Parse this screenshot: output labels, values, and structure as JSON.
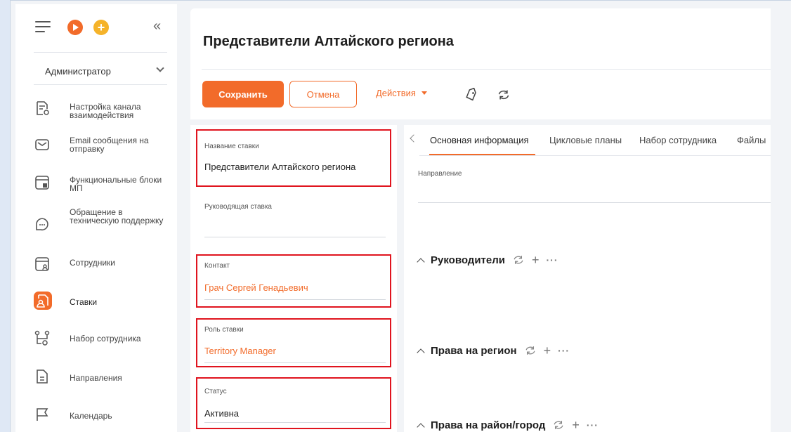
{
  "sidebar": {
    "role": "Администратор",
    "items": [
      {
        "label": "Настройка канала взаимодействия",
        "icon": "doc-settings-icon"
      },
      {
        "label": "Email сообщения на отправку",
        "icon": "mail-icon"
      },
      {
        "label": "Функциональные блоки МП",
        "icon": "blocks-icon"
      },
      {
        "label": "Обращение в техническую поддержку",
        "icon": "support-chat-icon"
      },
      {
        "label": "Сотрудники",
        "icon": "employee-card-icon"
      },
      {
        "label": "Ставки",
        "icon": "rates-icon",
        "active": true
      },
      {
        "label": "Набор сотрудника",
        "icon": "hierarchy-icon"
      },
      {
        "label": "Направления",
        "icon": "document-icon"
      },
      {
        "label": "Календарь",
        "icon": "flag-icon"
      }
    ]
  },
  "header": {
    "title": "Представители Алтайского региона",
    "save_label": "Сохранить",
    "cancel_label": "Отмена",
    "actions_label": "Действия"
  },
  "form": {
    "rate_name": {
      "label": "Название ставки",
      "value": "Представители Алтайского региона"
    },
    "parent_rate": {
      "label": "Руководящая ставка",
      "value": ""
    },
    "contact": {
      "label": "Контакт",
      "value": "Грач Сергей Генадьевич"
    },
    "rate_role": {
      "label": "Роль ставки",
      "value": "Territory Manager"
    },
    "status": {
      "label": "Статус",
      "value": "Активна"
    }
  },
  "main": {
    "tabs": [
      {
        "label": "Основная информация",
        "active": true
      },
      {
        "label": "Цикловые планы"
      },
      {
        "label": "Набор сотрудника"
      },
      {
        "label": "Файлы"
      }
    ],
    "direction_label": "Направление",
    "sections": [
      {
        "title": "Руководители"
      },
      {
        "title": "Права на регион"
      },
      {
        "title": "Права на район/город"
      }
    ]
  },
  "colors": {
    "accent": "#f26b2a",
    "highlight_box": "#e0141e",
    "plus_button": "#f5b32a"
  }
}
